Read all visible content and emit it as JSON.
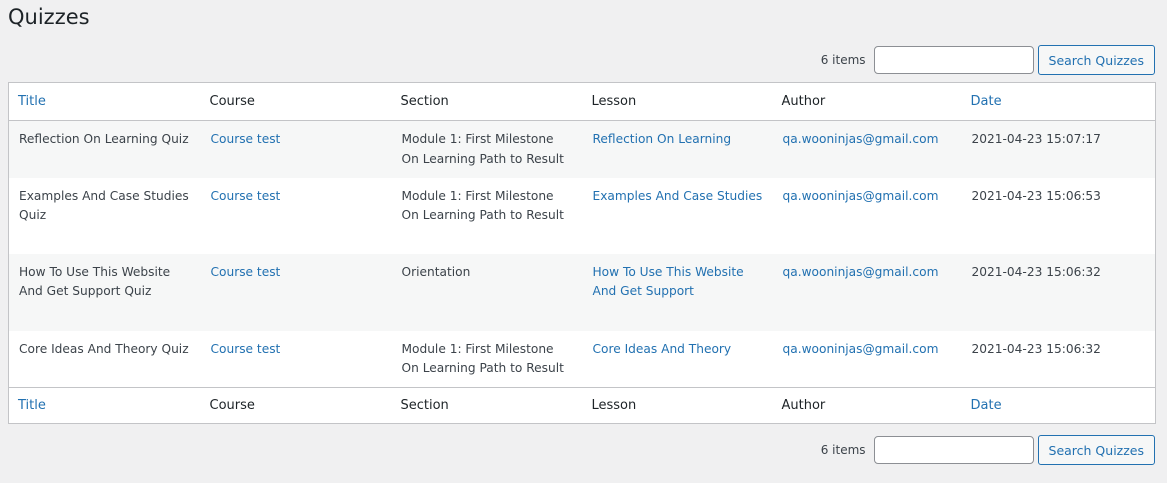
{
  "page": {
    "title": "Quizzes"
  },
  "tablenav": {
    "items_count": "6 items",
    "search_placeholder": "",
    "search_value": "",
    "search_button": "Search Quizzes"
  },
  "columns": {
    "title": "Title",
    "course": "Course",
    "section": "Section",
    "lesson": "Lesson",
    "author": "Author",
    "date": "Date"
  },
  "rows": [
    {
      "title": "Reflection On Learning Quiz",
      "course": "Course test",
      "section": "Module 1: First Milestone On Learning Path to Result",
      "lesson": "Reflection On Learning",
      "author": "qa.wooninjas@gmail.com",
      "date": "2021-04-23 15:07:17"
    },
    {
      "title": "Examples And Case Studies Quiz",
      "course": "Course test",
      "section": "Module 1: First Milestone On Learning Path to Result",
      "lesson": "Examples And Case Studies",
      "author": "qa.wooninjas@gmail.com",
      "date": "2021-04-23 15:06:53"
    },
    {
      "title": "How To Use This Website And Get Support Quiz",
      "course": "Course test",
      "section": "Orientation",
      "lesson": "How To Use This Website And Get Support",
      "author": "qa.wooninjas@gmail.com",
      "date": "2021-04-23 15:06:32"
    },
    {
      "title": "Core Ideas And Theory Quiz",
      "course": "Course test",
      "section": "Module 1: First Milestone On Learning Path to Result",
      "lesson": "Core Ideas And Theory",
      "author": "qa.wooninjas@gmail.com",
      "date": "2021-04-23 15:06:32"
    }
  ]
}
